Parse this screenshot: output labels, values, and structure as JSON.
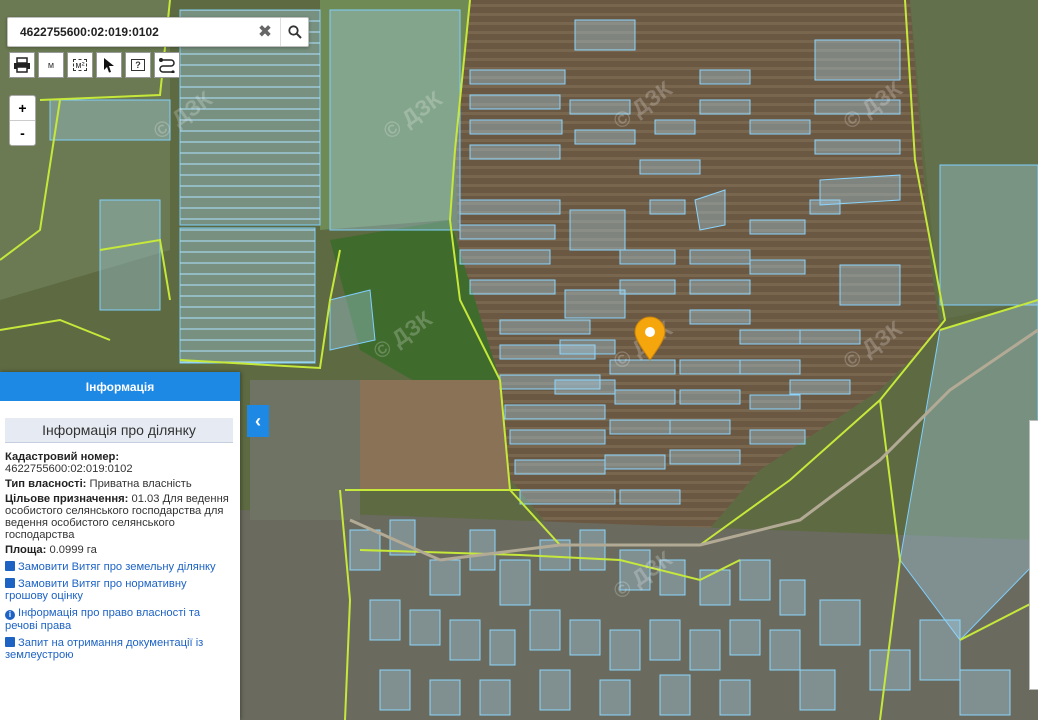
{
  "search": {
    "value": "4622755600:02:019:0102",
    "clear_icon": "close-icon",
    "search_icon": "search-icon"
  },
  "toolbar": {
    "tools": [
      {
        "name": "print-icon"
      },
      {
        "name": "measure-distance-icon",
        "label": "м"
      },
      {
        "name": "measure-area-icon",
        "label": "м²"
      },
      {
        "name": "pointer-icon"
      },
      {
        "name": "info-query-icon",
        "label": "?"
      },
      {
        "name": "route-icon"
      }
    ]
  },
  "zoom": {
    "in": "+",
    "out": "-"
  },
  "panel": {
    "title": "Інформація",
    "subtitle": "Інформація про ділянку",
    "cadastral_label": "Кадастровий номер:",
    "cadastral_value": "4622755600:02:019:0102",
    "ownership_label": "Тип власності:",
    "ownership_value": "Приватна власність",
    "purpose_label": "Цільове призначення:",
    "purpose_value": "01.03 Для ведення особистого селянського господарства для ведення особистого селянського господарства",
    "area_label": "Площа:",
    "area_value": "0.0999 га",
    "links": [
      "Замовити Витяг про земельну ділянку",
      "Замовити Витяг про нормативну грошову оцінку",
      "Інформація про право власності та речові права",
      "Запит на отримання документації із землеустрою"
    ]
  },
  "collapse_icon": "chevron-left-icon",
  "colors": {
    "parcel_fill": "#a8d8f0",
    "parcel_stroke": "#6ec6ff",
    "boundary": "#c6e83a",
    "marker": "#f5a60d",
    "accent": "#1e88e5"
  }
}
